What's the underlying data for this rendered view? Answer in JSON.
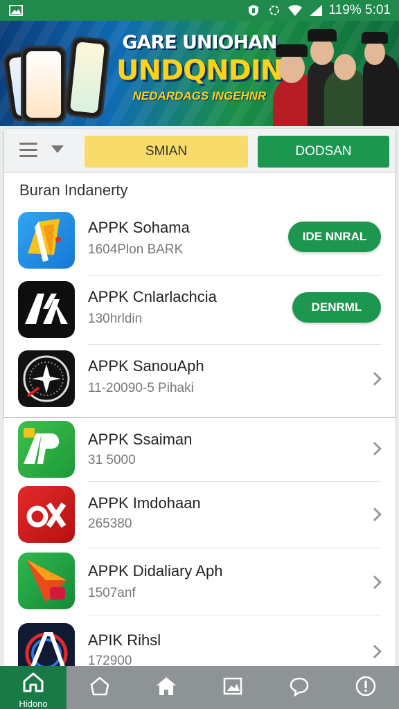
{
  "status_bar": {
    "battery_text": "119% 5:01",
    "icons": [
      "gallery-icon",
      "vpn-icon",
      "sync-icon",
      "wifi-icon",
      "signal-icon"
    ]
  },
  "banner": {
    "headline": "GARE UNIOHAN",
    "title": "UNDQNDIN",
    "subtitle": "NEDARDAGS INGEHNR"
  },
  "toolbar": {
    "menu_icon": "hamburger-icon",
    "dropdown_icon": "caret-down-icon",
    "primary_button": "SMIAN",
    "secondary_button": "DODSAN"
  },
  "section_title": "Buran Indanerty",
  "apps_top": [
    {
      "title": "APPK Sohama",
      "subtitle": "1604Plon BARK",
      "action": "IDE NNRAL",
      "icon": "pencil-app-icon"
    },
    {
      "title": "APPK Cnlarlachcia",
      "subtitle": "130hrldin",
      "action": "DENRML",
      "icon": "ay-app-icon"
    },
    {
      "title": "APPK SanouAph",
      "subtitle": "11-20090-5 Pihaki",
      "action": "",
      "icon": "compass-app-icon"
    }
  ],
  "apps_bottom": [
    {
      "title": "APPK Ssaiman",
      "subtitle": "31 5000",
      "icon": "ap-app-icon"
    },
    {
      "title": "APPK Imdohaan",
      "subtitle": "265380",
      "icon": "ox-app-icon"
    },
    {
      "title": "APPK Didaliary Aph",
      "subtitle": "1507anf",
      "icon": "arrow-app-icon"
    },
    {
      "title": "APIK Rihsl",
      "subtitle": "172900",
      "icon": "a-ring-app-icon"
    }
  ],
  "bottom_nav": {
    "active_label": "Hidono",
    "items": [
      "home-icon",
      "home-outline-icon",
      "house-icon",
      "image-icon",
      "chat-icon",
      "info-icon"
    ]
  },
  "colors": {
    "green": "#1d9650",
    "yellow": "#f7dc6b",
    "status_bar": "#1f8a4c",
    "nav_bg": "#8e9496"
  }
}
